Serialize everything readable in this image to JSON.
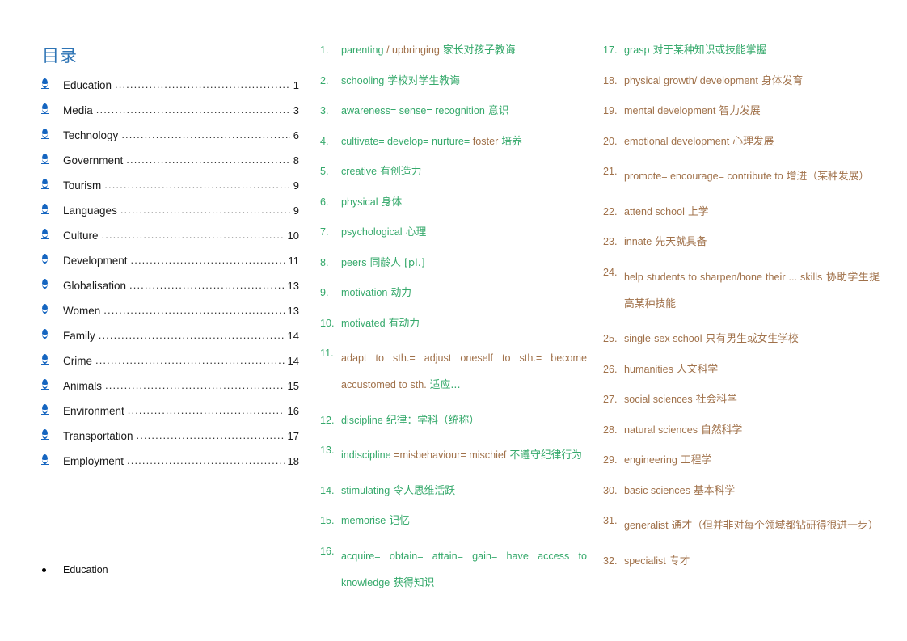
{
  "colors": {
    "toc_title": "#2E74B5",
    "toc_bullet": "#1565C0",
    "green": "#35A96B",
    "brown": "#A0714A",
    "text": "#1a1a1a"
  },
  "toc": {
    "title": "目录",
    "leader": "................................................................................................",
    "items": [
      {
        "label": "Education",
        "page": "1"
      },
      {
        "label": "Media",
        "page": "3"
      },
      {
        "label": "Technology",
        "page": "6"
      },
      {
        "label": "Government",
        "page": "8"
      },
      {
        "label": "Tourism",
        "page": "9"
      },
      {
        "label": "Languages",
        "page": "9"
      },
      {
        "label": "Culture",
        "page": "10"
      },
      {
        "label": "Development",
        "page": "11"
      },
      {
        "label": "Globalisation",
        "page": "13"
      },
      {
        "label": "Women",
        "page": "13"
      },
      {
        "label": "Family",
        "page": "14"
      },
      {
        "label": "Crime",
        "page": "14"
      },
      {
        "label": "Animals",
        "page": "15"
      },
      {
        "label": "Environment",
        "page": "16"
      },
      {
        "label": "Transportation",
        "page": "17"
      },
      {
        "label": "Employment",
        "page": "18"
      }
    ],
    "section_heading": "Education"
  },
  "vocab_middle": [
    {
      "num": "1.",
      "en": "parenting",
      "en2": " / upbringing",
      "cn": " 家长对孩子教诲",
      "en_color": "green",
      "en2_color": "brown",
      "cn_color": "green"
    },
    {
      "num": "2.",
      "en": "schooling",
      "en2": "",
      "cn": " 学校对学生教诲",
      "en_color": "green",
      "en2_color": "green",
      "cn_color": "green"
    },
    {
      "num": "3.",
      "en": "awareness= sense= recognition",
      "en2": "",
      "cn": " 意识",
      "en_color": "green",
      "en2_color": "green",
      "cn_color": "green"
    },
    {
      "num": "4.",
      "en": "cultivate= develop= nurture= ",
      "en2": "foster",
      "cn": " 培养",
      "en_color": "green",
      "en2_color": "brown",
      "cn_color": "green"
    },
    {
      "num": "5.",
      "en": "creative",
      "en2": "",
      "cn": " 有创造力",
      "en_color": "green",
      "en2_color": "green",
      "cn_color": "green"
    },
    {
      "num": "6.",
      "en": "physical",
      "en2": "",
      "cn": " 身体",
      "en_color": "green",
      "en2_color": "green",
      "cn_color": "green"
    },
    {
      "num": "7.",
      "en": "psychological",
      "en2": "",
      "cn": " 心理",
      "en_color": "green",
      "en2_color": "green",
      "cn_color": "green"
    },
    {
      "num": "8.",
      "en": "peers",
      "en2": "",
      "cn": " 同龄人 [pl.]",
      "en_color": "green",
      "en2_color": "green",
      "cn_color": "green"
    },
    {
      "num": "9.",
      "en": "motivation",
      "en2": "",
      "cn": " 动力",
      "en_color": "green",
      "en2_color": "green",
      "cn_color": "green"
    },
    {
      "num": "10.",
      "en": "motivated",
      "en2": "",
      "cn": " 有动力",
      "en_color": "green",
      "en2_color": "green",
      "cn_color": "green"
    },
    {
      "num": "11.",
      "en": "adapt to sth.= adjust oneself to sth.= become accustomed to sth.",
      "en2": "",
      "cn": " 适应...",
      "en_color": "brown",
      "en2_color": "brown",
      "cn_color": "green",
      "wrap": true
    },
    {
      "num": "12.",
      "en": "discipline",
      "en2": "",
      "cn": " 纪律：学科（统称）",
      "en_color": "green",
      "en2_color": "green",
      "cn_color": "green"
    },
    {
      "num": "13.",
      "en": "indiscipline ",
      "en2": "=misbehaviour= mischief",
      "cn": " 不遵守纪律行为",
      "en_color": "green",
      "en2_color": "brown",
      "cn_color": "green",
      "wrap": true
    },
    {
      "num": "14.",
      "en": "stimulating",
      "en2": "",
      "cn": " 令人思维活跃",
      "en_color": "green",
      "en2_color": "green",
      "cn_color": "green"
    },
    {
      "num": "15.",
      "en": "memorise",
      "en2": "",
      "cn": " 记忆",
      "en_color": "green",
      "en2_color": "green",
      "cn_color": "green"
    },
    {
      "num": "16.",
      "en": "acquire= obtain= attain= gain= have access to knowledge",
      "en2": "",
      "cn": " 获得知识",
      "en_color": "green",
      "en2_color": "green",
      "cn_color": "green",
      "wrap": true
    }
  ],
  "vocab_right": [
    {
      "num": "17.",
      "en": "grasp",
      "en2": "",
      "cn": " 对于某种知识或技能掌握",
      "num_color": "green",
      "en_color": "green",
      "en2_color": "green",
      "cn_color": "green"
    },
    {
      "num": "18.",
      "en": "physical growth/ development",
      "en2": "",
      "cn": " 身体发育",
      "num_color": "brown",
      "en_color": "brown",
      "en2_color": "brown",
      "cn_color": "brown"
    },
    {
      "num": "19.",
      "en": "mental development",
      "en2": "",
      "cn": " 智力发展",
      "num_color": "brown",
      "en_color": "brown",
      "en2_color": "brown",
      "cn_color": "brown"
    },
    {
      "num": "20.",
      "en": "emotional development",
      "en2": "",
      "cn": " 心理发展",
      "num_color": "brown",
      "en_color": "brown",
      "en2_color": "brown",
      "cn_color": "brown"
    },
    {
      "num": "21.",
      "en": "promote= encourage= contribute to",
      "en2": "",
      "cn": " 增进（某种发展）",
      "num_color": "brown",
      "en_color": "brown",
      "en2_color": "brown",
      "cn_color": "brown",
      "wrap": true
    },
    {
      "num": "22.",
      "en": "attend school",
      "en2": "",
      "cn": " 上学",
      "num_color": "brown",
      "en_color": "brown",
      "en2_color": "brown",
      "cn_color": "brown"
    },
    {
      "num": "23.",
      "en": "innate",
      "en2": "",
      "cn": " 先天就具备",
      "num_color": "brown",
      "en_color": "brown",
      "en2_color": "brown",
      "cn_color": "brown"
    },
    {
      "num": "24.",
      "en": "help students to sharpen/hone their ... skills",
      "en2": "",
      "cn": " 协助学生提高某种技能",
      "num_color": "brown",
      "en_color": "brown",
      "en2_color": "brown",
      "cn_color": "brown",
      "wrap": true
    },
    {
      "num": "25.",
      "en": "single-sex school",
      "en2": "",
      "cn": " 只有男生或女生学校",
      "num_color": "brown",
      "en_color": "brown",
      "en2_color": "brown",
      "cn_color": "brown"
    },
    {
      "num": "26.",
      "en": "humanities",
      "en2": "",
      "cn": " 人文科学",
      "num_color": "brown",
      "en_color": "brown",
      "en2_color": "brown",
      "cn_color": "brown"
    },
    {
      "num": "27.",
      "en": "social sciences",
      "en2": "",
      "cn": " 社会科学",
      "num_color": "brown",
      "en_color": "brown",
      "en2_color": "brown",
      "cn_color": "brown"
    },
    {
      "num": "28.",
      "en": "natural sciences",
      "en2": "",
      "cn": " 自然科学",
      "num_color": "brown",
      "en_color": "brown",
      "en2_color": "brown",
      "cn_color": "brown"
    },
    {
      "num": "29.",
      "en": "engineering",
      "en2": "",
      "cn": " 工程学",
      "num_color": "brown",
      "en_color": "brown",
      "en2_color": "brown",
      "cn_color": "brown"
    },
    {
      "num": "30.",
      "en": "basic sciences",
      "en2": "",
      "cn": " 基本科学",
      "num_color": "brown",
      "en_color": "brown",
      "en2_color": "brown",
      "cn_color": "brown"
    },
    {
      "num": "31.",
      "en": "generalist",
      "en2": "",
      "cn": " 通才（但并非对每个领域都钻研得很进一步）",
      "num_color": "brown",
      "en_color": "brown",
      "en2_color": "brown",
      "cn_color": "brown",
      "wrap": true
    },
    {
      "num": "32.",
      "en": "specialist",
      "en2": "",
      "cn": " 专才",
      "num_color": "brown",
      "en_color": "brown",
      "en2_color": "brown",
      "cn_color": "brown"
    }
  ]
}
